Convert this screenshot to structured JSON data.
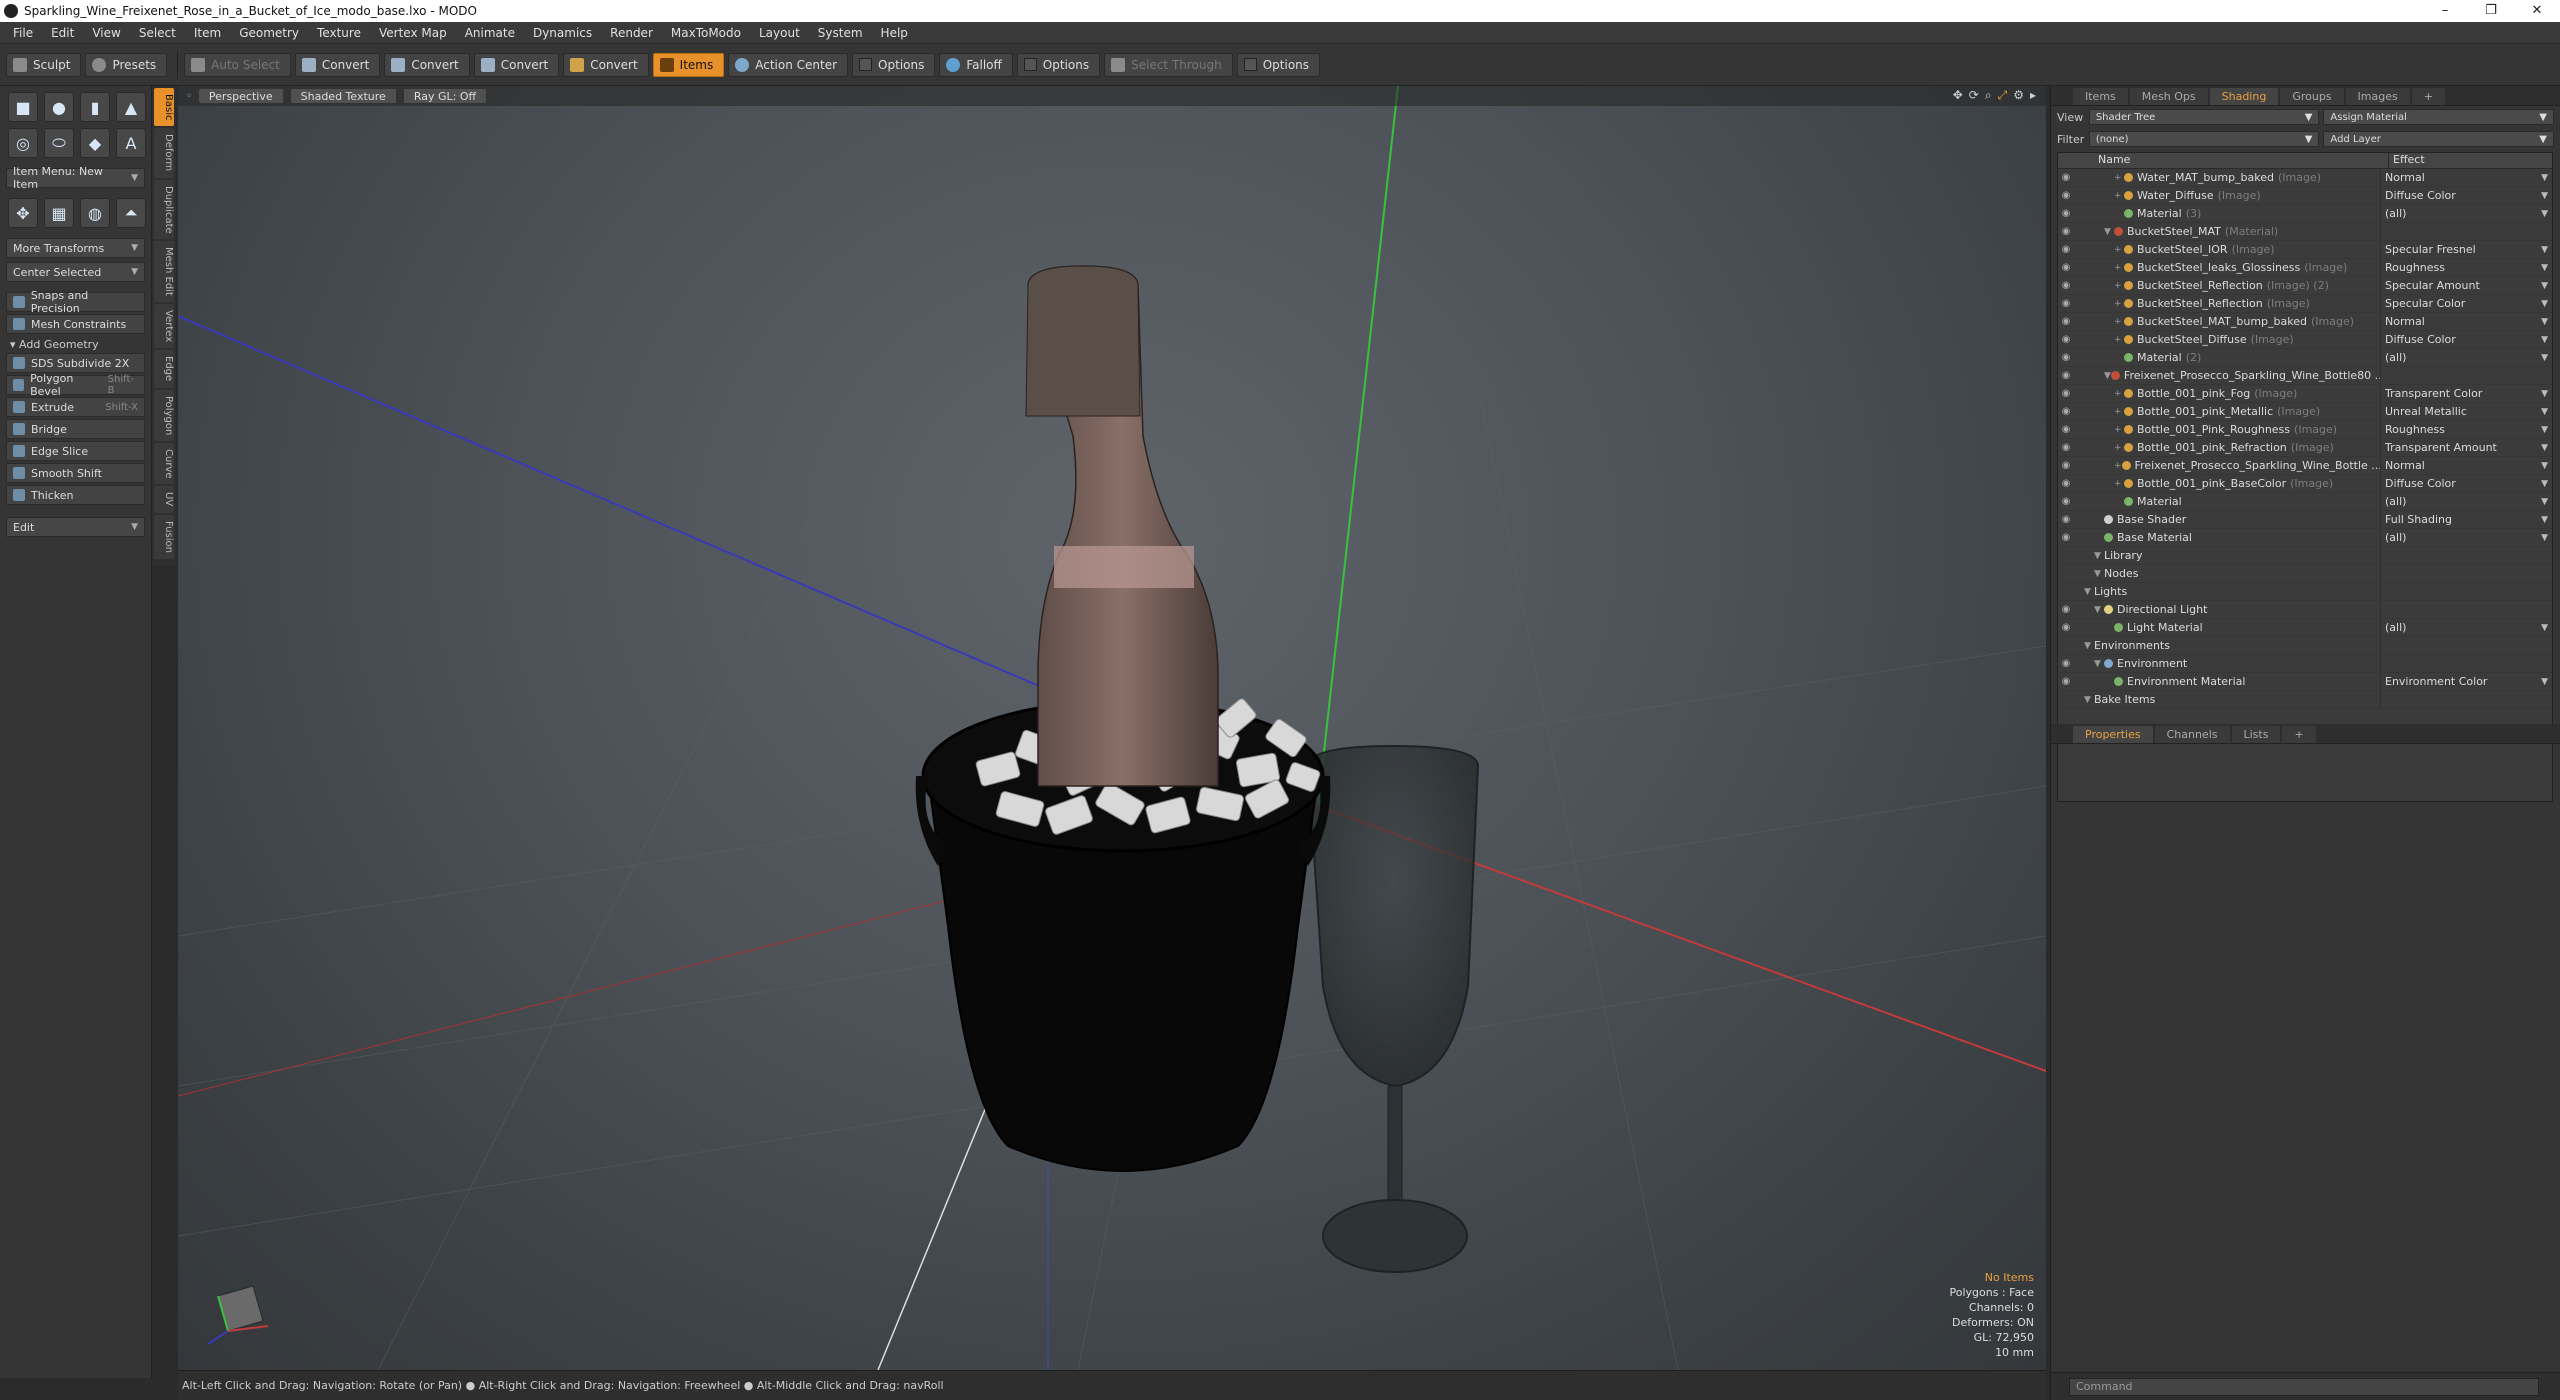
{
  "window": {
    "title": "Sparkling_Wine_Freixenet_Rose_in_a_Bucket_of_Ice_modo_base.lxo - MODO",
    "controls": [
      "–",
      "❐",
      "✕"
    ]
  },
  "menu": [
    "File",
    "Edit",
    "View",
    "Select",
    "Item",
    "Geometry",
    "Texture",
    "Vertex Map",
    "Animate",
    "Dynamics",
    "Render",
    "MaxToModo",
    "Layout",
    "System",
    "Help"
  ],
  "toolbar": {
    "sculpt": "Sculpt",
    "presets": "Presets",
    "auto_select": "Auto Select",
    "convert1": "Convert",
    "convert2": "Convert",
    "convert3": "Convert",
    "convert4": "Convert",
    "items": "Items",
    "action_center": "Action Center",
    "options1": "Options",
    "falloff": "Falloff",
    "options2": "Options",
    "select_through": "Select Through",
    "options3": "Options"
  },
  "left_panel": {
    "vertical_tabs": [
      "Basic",
      "Deform",
      "Duplicate",
      "Mesh Edit",
      "Vertex",
      "Edge",
      "Polygon",
      "Curve",
      "UV",
      "Fusion"
    ],
    "item_menu": "Item Menu: New Item",
    "more_transforms": "More Transforms",
    "center_selected": "Center Selected",
    "snaps": "Snaps and Precision",
    "mesh_constraints": "Mesh Constraints",
    "add_geometry": "Add Geometry",
    "tools": [
      {
        "label": "SDS Subdivide 2X",
        "shortcut": ""
      },
      {
        "label": "Polygon Bevel",
        "shortcut": "Shift-B"
      },
      {
        "label": "Extrude",
        "shortcut": "Shift-X"
      },
      {
        "label": "Bridge",
        "shortcut": ""
      },
      {
        "label": "Edge Slice",
        "shortcut": ""
      },
      {
        "label": "Smooth Shift",
        "shortcut": ""
      },
      {
        "label": "Thicken",
        "shortcut": ""
      }
    ],
    "edit": "Edit"
  },
  "viewport": {
    "perspective": "Perspective",
    "shaded": "Shaded Texture",
    "raygl": "Ray GL: Off",
    "info": {
      "no_items": "No Items",
      "polygons": "Polygons : Face",
      "channels": "Channels: 0",
      "deformers": "Deformers: ON",
      "gl": "GL: 72,950",
      "scale": "10 mm"
    }
  },
  "status_bar": "Alt-Left Click and Drag: Navigation: Rotate (or Pan) ● Alt-Right Click and Drag: Navigation: Freewheel ● Alt-Middle Click and Drag: navRoll",
  "right_panel": {
    "tabs": [
      "Items",
      "Mesh Ops",
      "Shading",
      "Groups",
      "Images",
      "+"
    ],
    "view_label": "View",
    "view_value": "Shader Tree",
    "assign_material": "Assign Material",
    "filter_label": "Filter",
    "filter_value": "(none)",
    "add_layer": "Add Layer",
    "col_name": "Name",
    "col_effect": "Effect",
    "rows": [
      {
        "indent": 4,
        "icon": "img",
        "name": "Water_MAT_bump_baked",
        "sub": "(Image)",
        "effect": "Normal"
      },
      {
        "indent": 4,
        "icon": "img",
        "name": "Water_Diffuse",
        "sub": "(Image)",
        "effect": "Diffuse Color"
      },
      {
        "indent": 4,
        "icon": "mat",
        "name": "Material",
        "sub": "(3)",
        "effect": "(all)"
      },
      {
        "indent": 3,
        "icon": "matred",
        "name": "BucketSteel_MAT",
        "sub": "(Material)",
        "effect": ""
      },
      {
        "indent": 4,
        "icon": "img",
        "name": "BucketSteel_IOR",
        "sub": "(Image)",
        "effect": "Specular Fresnel"
      },
      {
        "indent": 4,
        "icon": "img",
        "name": "BucketSteel_leaks_Glossiness",
        "sub": "(Image)",
        "effect": "Roughness"
      },
      {
        "indent": 4,
        "icon": "img",
        "name": "BucketSteel_Reflection",
        "sub": "(Image) (2)",
        "effect": "Specular Amount"
      },
      {
        "indent": 4,
        "icon": "img",
        "name": "BucketSteel_Reflection",
        "sub": "(Image)",
        "effect": "Specular Color"
      },
      {
        "indent": 4,
        "icon": "img",
        "name": "BucketSteel_MAT_bump_baked",
        "sub": "(Image)",
        "effect": "Normal"
      },
      {
        "indent": 4,
        "icon": "img",
        "name": "BucketSteel_Diffuse",
        "sub": "(Image)",
        "effect": "Diffuse Color"
      },
      {
        "indent": 4,
        "icon": "mat",
        "name": "Material",
        "sub": "(2)",
        "effect": "(all)"
      },
      {
        "indent": 3,
        "icon": "matred",
        "name": "Freixenet_Prosecco_Sparkling_Wine_Bottle80 ...",
        "sub": "",
        "effect": ""
      },
      {
        "indent": 4,
        "icon": "img",
        "name": "Bottle_001_pink_Fog",
        "sub": "(Image)",
        "effect": "Transparent Color"
      },
      {
        "indent": 4,
        "icon": "img",
        "name": "Bottle_001_pink_Metallic",
        "sub": "(Image)",
        "effect": "Unreal Metallic"
      },
      {
        "indent": 4,
        "icon": "img",
        "name": "Bottle_001_Pink_Roughness",
        "sub": "(Image)",
        "effect": "Roughness"
      },
      {
        "indent": 4,
        "icon": "img",
        "name": "Bottle_001_pink_Refraction",
        "sub": "(Image)",
        "effect": "Transparent Amount"
      },
      {
        "indent": 4,
        "icon": "img",
        "name": "Freixenet_Prosecco_Sparkling_Wine_Bottle ...",
        "sub": "",
        "effect": "Normal"
      },
      {
        "indent": 4,
        "icon": "img",
        "name": "Bottle_001_pink_BaseColor",
        "sub": "(Image)",
        "effect": "Diffuse Color"
      },
      {
        "indent": 4,
        "icon": "mat",
        "name": "Material",
        "sub": "",
        "effect": "(all)"
      },
      {
        "indent": 2,
        "icon": "shd",
        "name": "Base Shader",
        "sub": "",
        "effect": "Full Shading"
      },
      {
        "indent": 2,
        "icon": "mat",
        "name": "Base Material",
        "sub": "",
        "effect": "(all)"
      },
      {
        "indent": 2,
        "icon": "",
        "name": "Library",
        "sub": "",
        "effect": ""
      },
      {
        "indent": 2,
        "icon": "",
        "name": "Nodes",
        "sub": "",
        "effect": ""
      },
      {
        "indent": 1,
        "icon": "",
        "name": "Lights",
        "sub": "",
        "effect": ""
      },
      {
        "indent": 2,
        "icon": "light",
        "name": "Directional Light",
        "sub": "",
        "effect": ""
      },
      {
        "indent": 3,
        "icon": "mat",
        "name": "Light Material",
        "sub": "",
        "effect": "(all)"
      },
      {
        "indent": 1,
        "icon": "",
        "name": "Environments",
        "sub": "",
        "effect": ""
      },
      {
        "indent": 2,
        "icon": "env",
        "name": "Environment",
        "sub": "",
        "effect": ""
      },
      {
        "indent": 3,
        "icon": "mat",
        "name": "Environment Material",
        "sub": "",
        "effect": "Environment Color"
      },
      {
        "indent": 1,
        "icon": "",
        "name": "Bake Items",
        "sub": "",
        "effect": ""
      }
    ],
    "props_tabs": [
      "Properties",
      "Channels",
      "Lists",
      "+"
    ],
    "command_placeholder": "Command"
  }
}
